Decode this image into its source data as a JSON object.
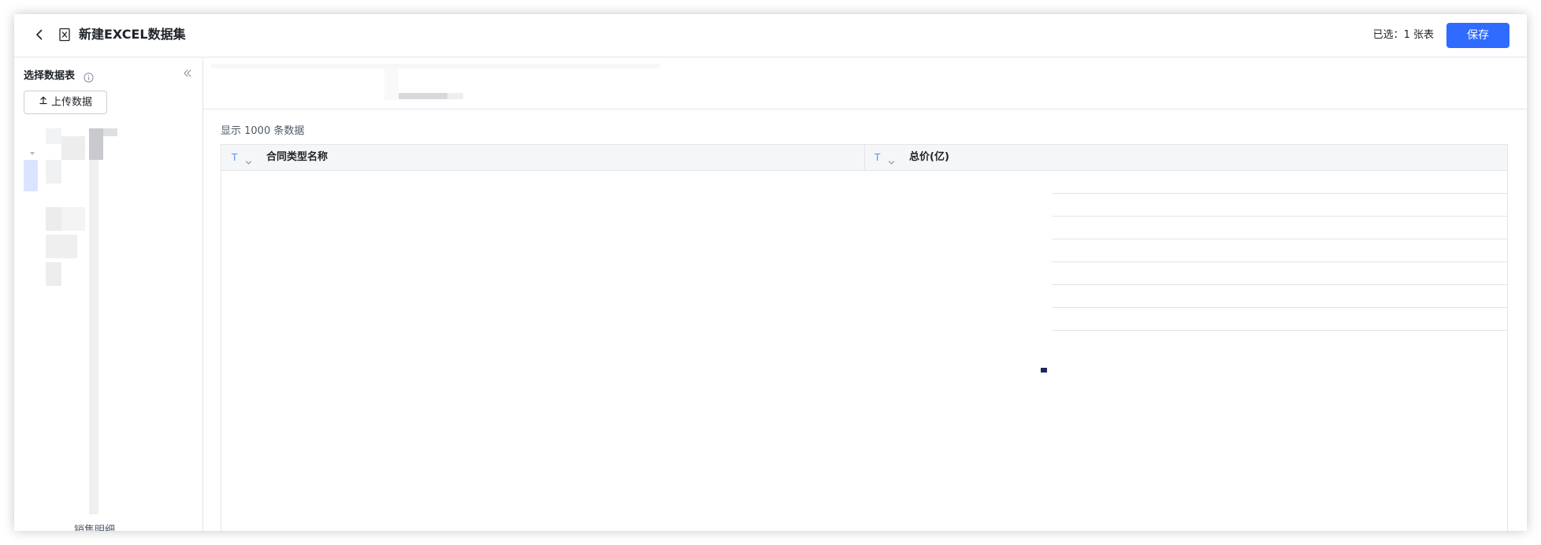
{
  "header": {
    "title": "新建EXCEL数据集",
    "selected_label": "已选：",
    "selected_count": "1 张表",
    "save_label": "保存"
  },
  "sidebar": {
    "title": "选择数据表",
    "upload_label": "上传数据",
    "bottom_item_label": "销售明细"
  },
  "main": {
    "info_text": "显示 1000 条数据",
    "columns": [
      {
        "type": "T",
        "name": "合同类型名称"
      },
      {
        "type": "T",
        "name": "总价(亿)"
      }
    ],
    "row_count": 7
  },
  "colors": {
    "accent": "#2f6bff",
    "type_icon": "#5b8ff9",
    "border": "#e3e5ea",
    "header_bg": "#f5f6f7"
  },
  "icons": [
    "back-icon",
    "excel-file-icon",
    "info-icon",
    "collapse-icon",
    "upload-icon",
    "chevron-down-icon",
    "caret-down-icon"
  ]
}
